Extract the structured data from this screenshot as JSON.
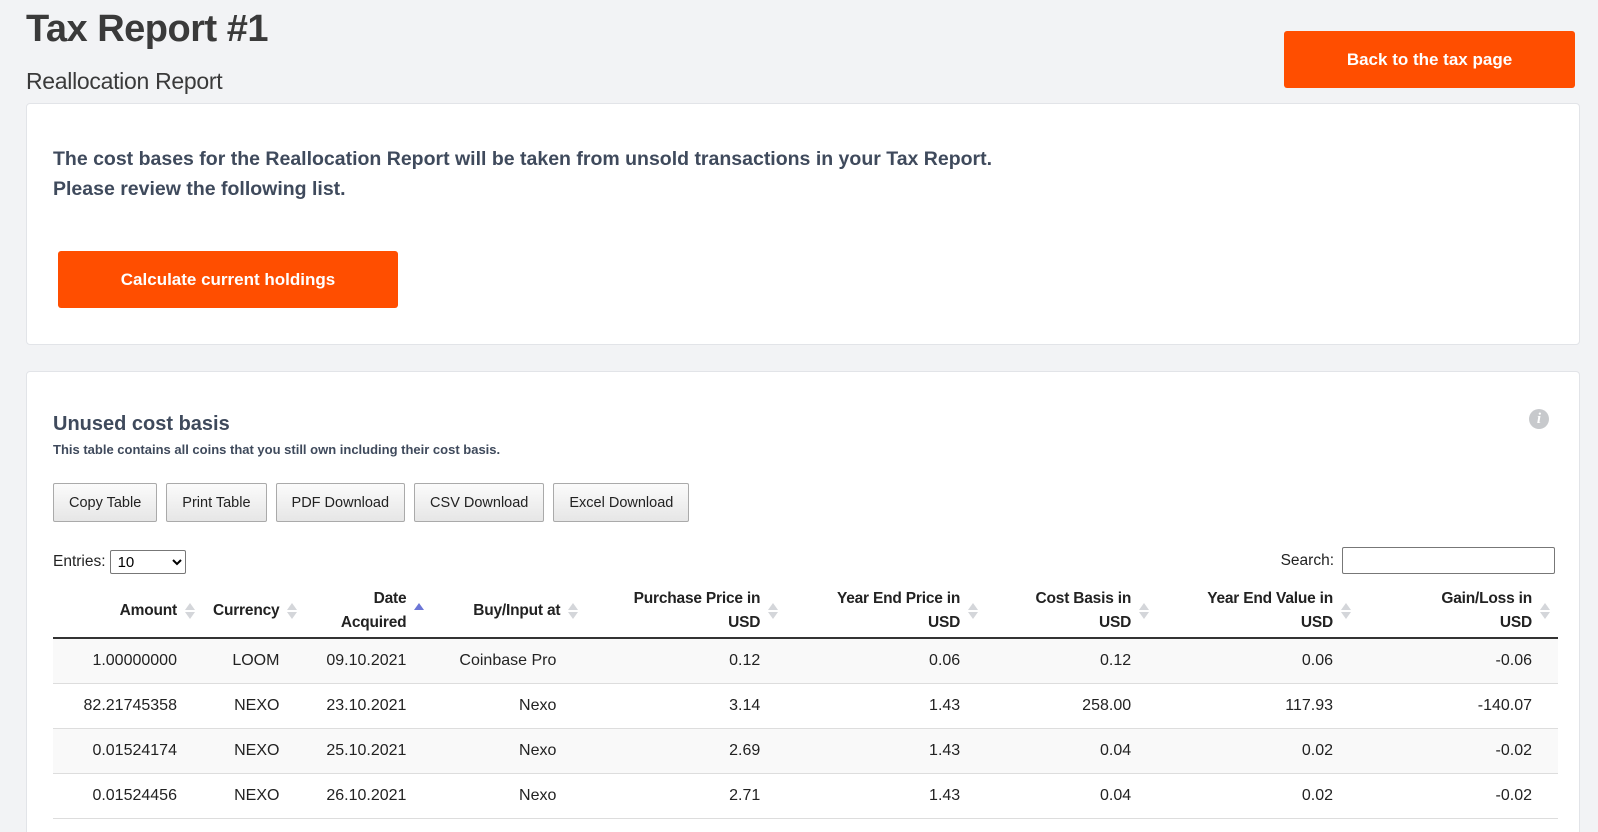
{
  "header": {
    "title": "Tax Report #1",
    "subtitle": "Reallocation Report",
    "back_button": "Back to the tax page"
  },
  "intro": {
    "line1": "The cost bases for the Reallocation Report will be taken from unsold transactions in your Tax Report.",
    "line2": "Please review the following list.",
    "calc_button": "Calculate current holdings"
  },
  "section": {
    "title": "Unused cost basis",
    "description": "This table contains all coins that you still own including their cost basis.",
    "info_icon": "info-icon"
  },
  "export_buttons": [
    "Copy Table",
    "Print Table",
    "PDF Download",
    "CSV Download",
    "Excel Download"
  ],
  "entries": {
    "label": "Entries:",
    "value": "10",
    "options": [
      "10"
    ]
  },
  "search": {
    "label": "Search:",
    "value": "",
    "placeholder": ""
  },
  "table": {
    "columns": [
      {
        "line1": "Amount",
        "line2": "",
        "sort": "none"
      },
      {
        "line1": "Currency",
        "line2": "",
        "sort": "none"
      },
      {
        "line1": "Date",
        "line2": "Acquired",
        "sort": "asc"
      },
      {
        "line1": "Buy/Input at",
        "line2": "",
        "sort": "none"
      },
      {
        "line1": "Purchase Price in",
        "line2": "USD",
        "sort": "none"
      },
      {
        "line1": "Year End Price in",
        "line2": "USD",
        "sort": "none"
      },
      {
        "line1": "Cost Basis in",
        "line2": "USD",
        "sort": "none"
      },
      {
        "line1": "Year End Value in",
        "line2": "USD",
        "sort": "none"
      },
      {
        "line1": "Gain/Loss in",
        "line2": "USD",
        "sort": "none"
      }
    ],
    "rows": [
      [
        "1.00000000",
        "LOOM",
        "09.10.2021",
        "Coinbase Pro",
        "0.12",
        "0.06",
        "0.12",
        "0.06",
        "-0.06"
      ],
      [
        "82.21745358",
        "NEXO",
        "23.10.2021",
        "Nexo",
        "3.14",
        "1.43",
        "258.00",
        "117.93",
        "-140.07"
      ],
      [
        "0.01524174",
        "NEXO",
        "25.10.2021",
        "Nexo",
        "2.69",
        "1.43",
        "0.04",
        "0.02",
        "-0.02"
      ],
      [
        "0.01524456",
        "NEXO",
        "26.10.2021",
        "Nexo",
        "2.71",
        "1.43",
        "0.04",
        "0.02",
        "-0.02"
      ]
    ]
  },
  "colors": {
    "accent": "#ff4e00",
    "heading": "#3f4a5c",
    "sort_active": "#6c76d6"
  }
}
